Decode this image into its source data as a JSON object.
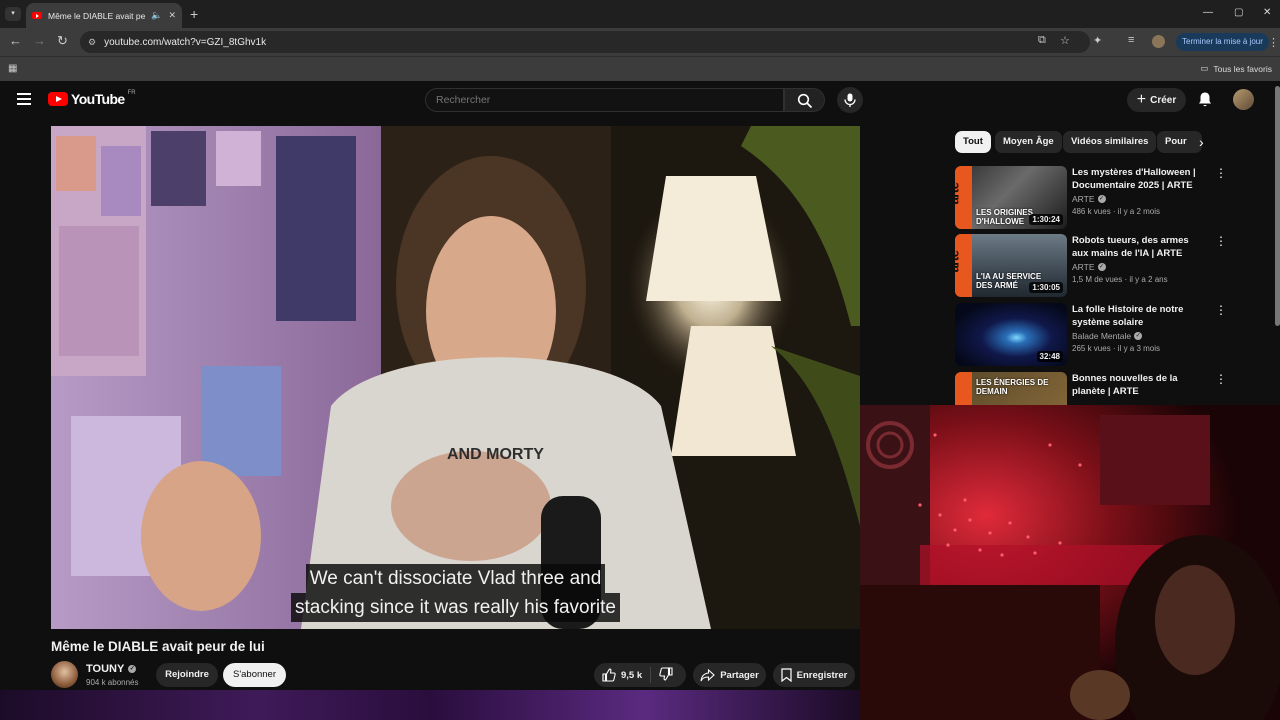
{
  "browser": {
    "tab_title": "Même le DIABLE avait peur de lui",
    "url": "youtube.com/watch?v=GZI_8tGhv1k",
    "update_button": "Terminer la mise à jour",
    "bookmarks_all": "Tous les favoris"
  },
  "youtube": {
    "logo_text": "YouTube",
    "region": "FR",
    "search_placeholder": "Rechercher",
    "create_label": "Créer"
  },
  "video": {
    "caption_line1": "We can't dissociate Vlad three and",
    "caption_line2": "stacking since it was really his favorite",
    "title": "Même le DIABLE avait peur de lui",
    "channel": "TOUNY",
    "subscribers": "904 k abonnés",
    "join_label": "Rejoindre",
    "subscribe_label": "S'abonner",
    "likes": "9,5 k",
    "share_label": "Partager",
    "save_label": "Enregistrer",
    "shirt_text": "AND MORTY"
  },
  "chips": [
    "Tout",
    "Moyen Âge",
    "Vidéos similaires",
    "Pour"
  ],
  "recommendations": [
    {
      "title": "Les mystères d'Halloween | Documentaire 2025 | ARTE",
      "channel": "ARTE",
      "meta": "486 k vues · il y a 2 mois",
      "duration": "1:30:24",
      "thumb_text": "LES ORIGINES D'HALLOWE"
    },
    {
      "title": "Robots tueurs, des armes aux mains de l'IA | ARTE",
      "channel": "ARTE",
      "meta": "1,5 M de vues · il y a 2 ans",
      "duration": "1:30:05",
      "thumb_text": "L'IA AU SERVICE DES ARMÉ"
    },
    {
      "title": "La folle Histoire de notre système solaire",
      "channel": "Balade Mentale",
      "meta": "265 k vues · il y a 3 mois",
      "duration": "32:48",
      "thumb_text": ""
    },
    {
      "title": "Bonnes nouvelles de la planète | ARTE",
      "channel": "",
      "meta": "",
      "duration": "",
      "thumb_text": "LES ÉNERGIES DE DEMAIN"
    }
  ],
  "colors": {
    "yt_red": "#ff0000",
    "arte_orange": "#e8581e",
    "bg": "#0f0f0f",
    "chip_bg": "#272727"
  }
}
